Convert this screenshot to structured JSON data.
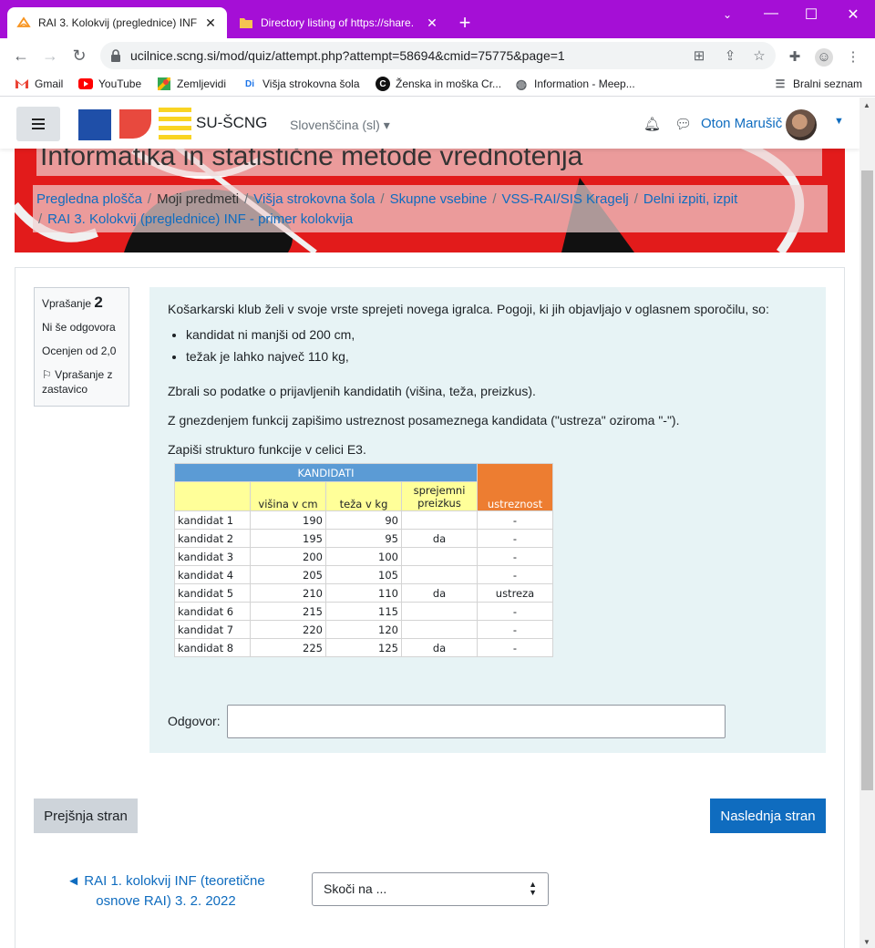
{
  "browser": {
    "tabs": [
      {
        "title": "RAI 3. Kolokvij (preglednice) INF",
        "active": true
      },
      {
        "title": "Directory listing of https://share.",
        "active": false
      }
    ],
    "url": "ucilnice.scng.si/mod/quiz/attempt.php?attempt=58694&cmid=75775&page=1",
    "bookmarks": [
      {
        "label": "Gmail",
        "icon": "gmail-icon"
      },
      {
        "label": "YouTube",
        "icon": "youtube-icon"
      },
      {
        "label": "Zemljevidi",
        "icon": "maps-icon"
      },
      {
        "label": "Višja strokovna šola",
        "icon": "school-icon"
      },
      {
        "label": "Ženska in moška Cr...",
        "icon": "c-icon"
      },
      {
        "label": "Information - Meep...",
        "icon": "globe-icon"
      }
    ],
    "reading_list": "Bralni seznam"
  },
  "navbar": {
    "brand": "SU-ŠCNG",
    "language": "Slovenščina (sl)",
    "user_name": "Oton Marušič"
  },
  "course": {
    "title": "Informatika in statistične metode vrednotenja",
    "breadcrumb": [
      "Pregledna plošča",
      "Moji predmeti",
      "Višja strokovna šola",
      "Skupne vsebine",
      "VSS-RAI/SIS Kragelj",
      "Delni izpiti, izpit",
      "RAI 3. Kolokvij (preglednice) INF - primer kolokvija"
    ]
  },
  "question_info": {
    "label": "Vprašanje",
    "number": "2",
    "status": "Ni še odgovora",
    "grade": "Ocenjen od 2,0",
    "flag": "Vprašanje z zastavico"
  },
  "question": {
    "intro": "Košarkarski klub želi v svoje vrste sprejeti novega igralca. Pogoji, ki jih objavljajo v oglasnem sporočilu, so:",
    "conditions": [
      "kandidat ni manjši od 200 cm,",
      "težak je lahko največ 110 kg,"
    ],
    "p1": "Zbrali so podatke o prijavljenih kandidatih (višina, teža, preizkus).",
    "p2": "Z gnezdenjem funkcij zapišimo ustreznost posameznega kandidata (\"ustreza\" oziroma \"-\").",
    "p3": "Zapiši strukturo funkcije v celici E3.",
    "answer_label": "Odgovor:"
  },
  "sheet": {
    "title": "KANDIDATI",
    "headers": [
      "višina v cm",
      "teža v kg",
      "sprejemni preizkus",
      "ustreznost"
    ],
    "rows": [
      {
        "name": "kandidat 1",
        "height": "190",
        "weight": "90",
        "test": "",
        "result": "-"
      },
      {
        "name": "kandidat 2",
        "height": "195",
        "weight": "95",
        "test": "da",
        "result": "-"
      },
      {
        "name": "kandidat 3",
        "height": "200",
        "weight": "100",
        "test": "",
        "result": "-"
      },
      {
        "name": "kandidat 4",
        "height": "205",
        "weight": "105",
        "test": "",
        "result": "-"
      },
      {
        "name": "kandidat 5",
        "height": "210",
        "weight": "110",
        "test": "da",
        "result": "ustreza"
      },
      {
        "name": "kandidat 6",
        "height": "215",
        "weight": "115",
        "test": "",
        "result": "-"
      },
      {
        "name": "kandidat 7",
        "height": "220",
        "weight": "120",
        "test": "",
        "result": "-"
      },
      {
        "name": "kandidat 8",
        "height": "225",
        "weight": "125",
        "test": "da",
        "result": "-"
      }
    ]
  },
  "nav_buttons": {
    "prev": "Prejšnja stran",
    "next": "Naslednja stran"
  },
  "footer_nav": {
    "prev_activity": "◄ RAI 1. kolokvij INF (teoretične osnove RAI) 3. 2. 2022",
    "jump_placeholder": "Skoči na ..."
  },
  "colors": {
    "tabbar": "#a50fd6",
    "primary": "#0f6cbf",
    "hero_red": "#e21b1b",
    "question_bg": "#e7f3f5",
    "sheet_header_blue": "#5b9bd5",
    "sheet_header_yellow": "#ffff99",
    "sheet_header_orange": "#ed7d31"
  }
}
